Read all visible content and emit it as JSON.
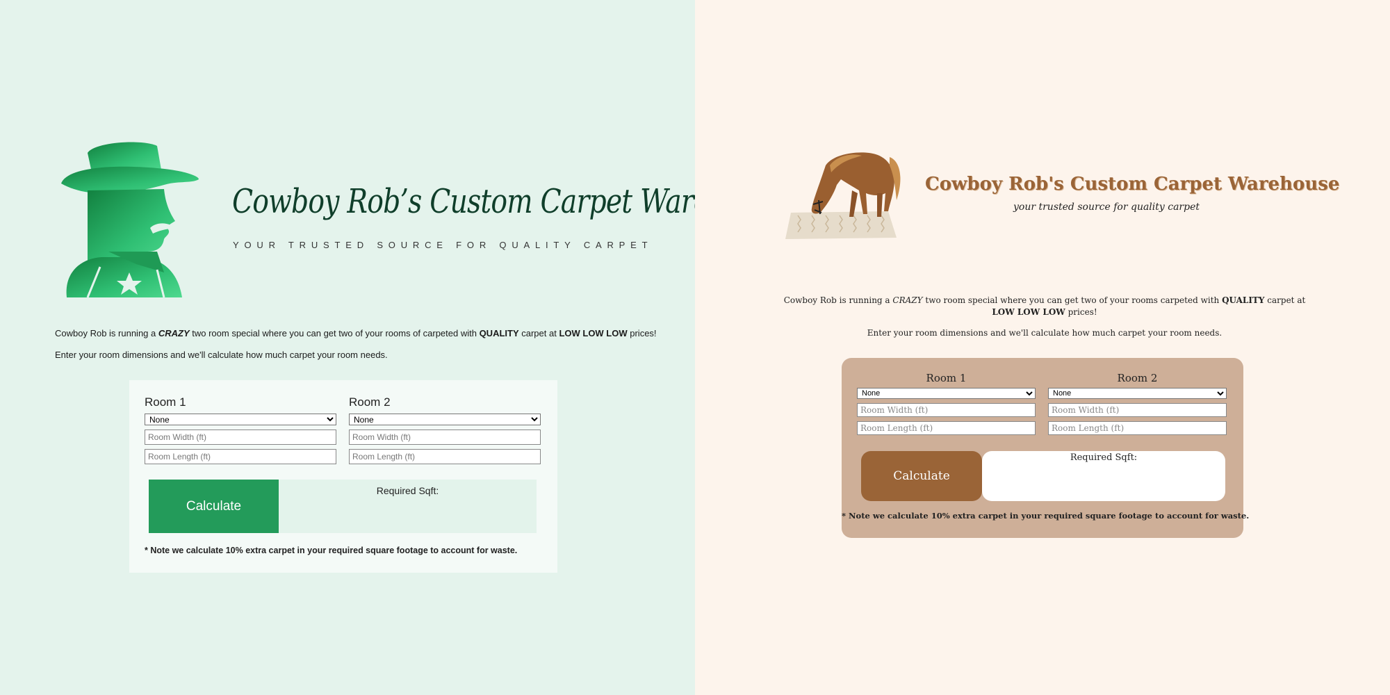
{
  "left_variant": {
    "theme": {
      "background": "#e4f3ec",
      "card": "#f4faf7",
      "accent": "#239b5a",
      "result_bg": "#e3f3eb",
      "title_color": "#0f3e2a"
    },
    "logo_icon": "cowboy-silhouette-icon",
    "title": "Cowboy Rob’s Custom Carpet Warehouse",
    "tagline": "YOUR TRUSTED SOURCE FOR QUALITY CARPET",
    "promo": {
      "t1": "Cowboy Rob is running a ",
      "crazy": "CRAZY",
      "t2": " two room special where you can get two of your rooms of carpeted with ",
      "quality": "QUALITY",
      "t3": " carpet at ",
      "low": "LOW LOW LOW",
      "t4": " prices!"
    },
    "instructions": "Enter your room dimensions and we'll calculate how much carpet your room needs.",
    "rooms": [
      {
        "title": "Room 1",
        "selected": "None",
        "width_placeholder": "Room Width (ft)",
        "length_placeholder": "Room Length (ft)"
      },
      {
        "title": "Room 2",
        "selected": "None",
        "width_placeholder": "Room Width (ft)",
        "length_placeholder": "Room Length (ft)"
      }
    ],
    "calculate_label": "Calculate",
    "result_label": "Required Sqft:",
    "note": "* Note we calculate 10% extra carpet in your required square footage to account for waste."
  },
  "right_variant": {
    "theme": {
      "background": "#fdf4ec",
      "card": "#ceaf98",
      "accent": "#9a6437",
      "result_bg": "#ffffff",
      "title_color": "#9a6437"
    },
    "logo_icon": "horse-on-carpet-icon",
    "title": "Cowboy Rob's Custom Carpet Warehouse",
    "tagline": "your trusted source for quality carpet",
    "promo": {
      "t1": "Cowboy Rob is running a ",
      "crazy": "CRAZY",
      "t2": " two room special where you can get two of your rooms carpeted with ",
      "quality": "QUALITY",
      "t3": " carpet at ",
      "low": "LOW LOW LOW",
      "t4": " prices!"
    },
    "instructions": "Enter your room dimensions and we'll calculate how much carpet your room needs.",
    "rooms": [
      {
        "title": "Room 1",
        "selected": "None",
        "width_placeholder": "Room Width (ft)",
        "length_placeholder": "Room Length (ft)"
      },
      {
        "title": "Room 2",
        "selected": "None",
        "width_placeholder": "Room Width (ft)",
        "length_placeholder": "Room Length (ft)"
      }
    ],
    "calculate_label": "Calculate",
    "result_label": "Required Sqft:",
    "note": "* Note we calculate 10% extra carpet in your required square footage to account for waste."
  }
}
